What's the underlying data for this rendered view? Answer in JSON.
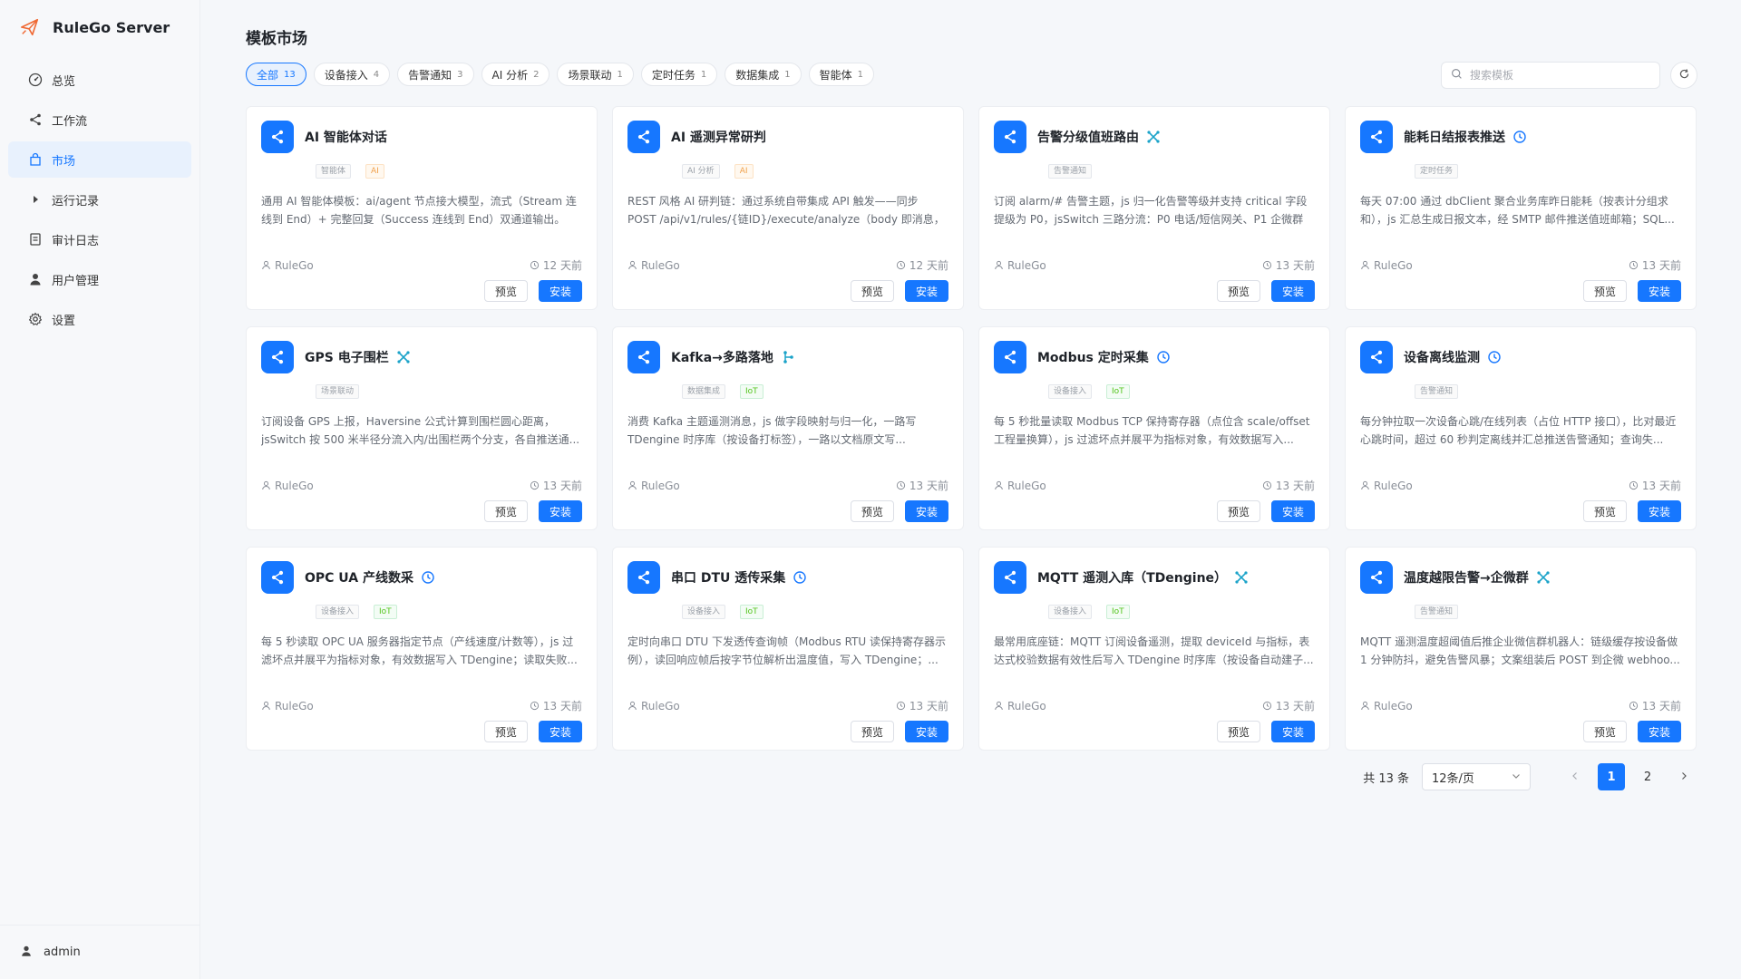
{
  "brand": {
    "title": "RuleGo Server"
  },
  "sidebar": {
    "items": [
      {
        "label": "总览",
        "icon": "dashboard-icon"
      },
      {
        "label": "工作流",
        "icon": "share-icon"
      },
      {
        "label": "市场",
        "icon": "shopping-bag-icon",
        "active": true
      },
      {
        "label": "运行记录",
        "icon": "caret-right-icon"
      },
      {
        "label": "审计日志",
        "icon": "document-icon"
      },
      {
        "label": "用户管理",
        "icon": "user-icon"
      },
      {
        "label": "设置",
        "icon": "gear-icon"
      }
    ],
    "user": "admin"
  },
  "page": {
    "title": "模板市场"
  },
  "filters": [
    {
      "label": "全部",
      "count": "13",
      "active": true
    },
    {
      "label": "设备接入",
      "count": "4"
    },
    {
      "label": "告警通知",
      "count": "3"
    },
    {
      "label": "AI 分析",
      "count": "2"
    },
    {
      "label": "场景联动",
      "count": "1"
    },
    {
      "label": "定时任务",
      "count": "1"
    },
    {
      "label": "数据集成",
      "count": "1"
    },
    {
      "label": "智能体",
      "count": "1"
    }
  ],
  "search": {
    "placeholder": "搜索模板"
  },
  "cards": [
    {
      "title": "AI 智能体对话",
      "mark": "",
      "tags": [
        "智能体",
        "AI"
      ],
      "desc": "通用 AI 智能体模板：ai/agent 节点接大模型，流式（Stream 连线到 End）+ 完整回复（Success 连线到 End）双通道输出。安...",
      "author": "RuleGo",
      "time": "12 天前"
    },
    {
      "title": "AI 遥测异常研判",
      "mark": "",
      "tags": [
        "AI 分析",
        "AI"
      ],
      "desc": "REST 风格 AI 研判链：通过系统自带集成 API 触发——同步 POST /api/v1/rules/{链ID}/execute/analyze（body 即消息，示例见...",
      "author": "RuleGo",
      "time": "12 天前"
    },
    {
      "title": "告警分级值班路由",
      "mark": "network-icon",
      "tags": [
        "告警通知"
      ],
      "desc": "订阅 alarm/# 告警主题，js 归一化告警等级并支持 critical 字段提级为 P0，jsSwitch 三路分流：P0 电话/短信网关、P1 企微群机...",
      "author": "RuleGo",
      "time": "13 天前"
    },
    {
      "title": "能耗日结报表推送",
      "mark": "clock-icon",
      "tags": [
        "定时任务"
      ],
      "desc": "每天 07:00 通过 dbClient 聚合业务库昨日能耗（按表计分组求和），js 汇总生成日报文本，经 SMTP 邮件推送值班邮箱；SQL...",
      "author": "RuleGo",
      "time": "13 天前"
    },
    {
      "title": "GPS 电子围栏",
      "mark": "network-icon",
      "tags": [
        "场景联动"
      ],
      "desc": "订阅设备 GPS 上报，Haversine 公式计算到围栏圆心距离，jsSwitch 按 500 米半径分流入内/出围栏两个分支，各自推送通...",
      "author": "RuleGo",
      "time": "13 天前"
    },
    {
      "title": "Kafka→多路落地",
      "mark": "fork-icon",
      "tags": [
        "数据集成",
        "IoT"
      ],
      "desc": "消费 Kafka 主题遥测消息，js 做字段映射与归一化，一路写 TDengine 时序库（按设备打标签），一路以文档原文写...",
      "author": "RuleGo",
      "time": "13 天前"
    },
    {
      "title": "Modbus 定时采集",
      "mark": "clock-icon",
      "tags": [
        "设备接入",
        "IoT"
      ],
      "desc": "每 5 秒批量读取 Modbus TCP 保持寄存器（点位含 scale/offset 工程量换算），js 过滤坏点并展平为指标对象，有效数据写入...",
      "author": "RuleGo",
      "time": "13 天前"
    },
    {
      "title": "设备离线监测",
      "mark": "clock-icon",
      "tags": [
        "告警通知"
      ],
      "desc": "每分钟拉取一次设备心跳/在线列表（占位 HTTP 接口），比对最近心跳时间，超过 60 秒判定离线并汇总推送告警通知；查询失...",
      "author": "RuleGo",
      "time": "13 天前"
    },
    {
      "title": "OPC UA 产线数采",
      "mark": "clock-icon",
      "tags": [
        "设备接入",
        "IoT"
      ],
      "desc": "每 5 秒读取 OPC UA 服务器指定节点（产线速度/计数等），js 过滤坏点并展平为指标对象，有效数据写入 TDengine；读取失败...",
      "author": "RuleGo",
      "time": "13 天前"
    },
    {
      "title": "串口 DTU 透传采集",
      "mark": "clock-icon",
      "tags": [
        "设备接入",
        "IoT"
      ],
      "desc": "定时向串口 DTU 下发透传查询帧（Modbus RTU 读保持寄存器示例），读回响应帧后按字节位解析出温度值，写入 TDengine；...",
      "author": "RuleGo",
      "time": "13 天前"
    },
    {
      "title": "MQTT 遥测入库（TDengine）",
      "mark": "network-icon",
      "tags": [
        "设备接入",
        "IoT"
      ],
      "desc": "最常用底座链：MQTT 订阅设备遥测，提取 deviceId 与指标，表达式校验数据有效性后写入 TDengine 时序库（按设备自动建子...",
      "author": "RuleGo",
      "time": "13 天前"
    },
    {
      "title": "温度越限告警→企微群",
      "mark": "network-icon",
      "tags": [
        "告警通知"
      ],
      "desc": "MQTT 遥测温度超阈值后推企业微信群机器人：链级缓存按设备做 1 分钟防抖，避免告警风暴；文案组装后 POST 到企微 webhoo...",
      "author": "RuleGo",
      "time": "13 天前"
    }
  ],
  "card_buttons": {
    "preview": "预览",
    "install": "安装"
  },
  "pagination": {
    "total": "共 13 条",
    "page_size": "12条/页",
    "pages": [
      "1",
      "2"
    ],
    "current": "1"
  },
  "colors": {
    "accent": "#1677ff"
  }
}
